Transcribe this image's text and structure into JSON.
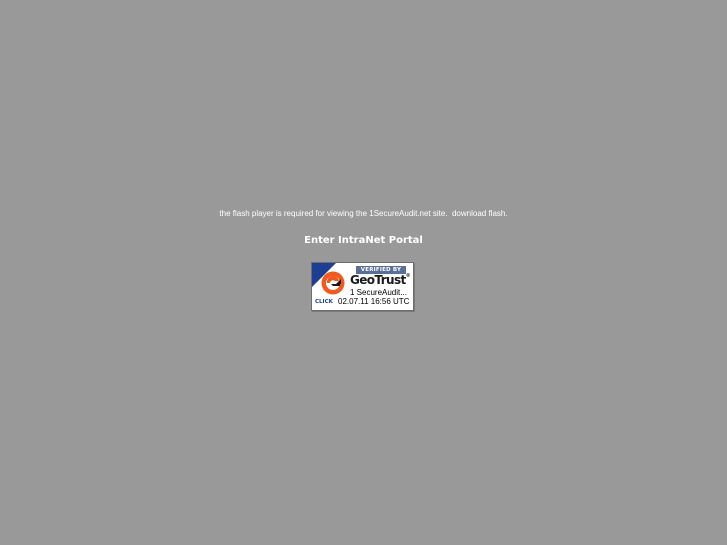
{
  "notice": {
    "text": "the flash player is required for viewing the 1SecureAudit.net site.",
    "download_link": "download flash."
  },
  "portal": {
    "link_label": "Enter IntraNet Portal"
  },
  "seal": {
    "verified_label": "VERIFIED BY",
    "brand_geo": "Geo",
    "brand_trust": "Trust",
    "trademark": "®",
    "site_name": "1 SecureAudit...",
    "click_label": "CLICK",
    "timestamp": "02.07.11 16:56 UTC",
    "colors": {
      "corner": "#1c3f94",
      "swirl": "#f05a1e",
      "band": "#5a6e9a"
    },
    "icon": "geotrust-swirl-icon"
  },
  "page": {
    "background": "#999999"
  }
}
